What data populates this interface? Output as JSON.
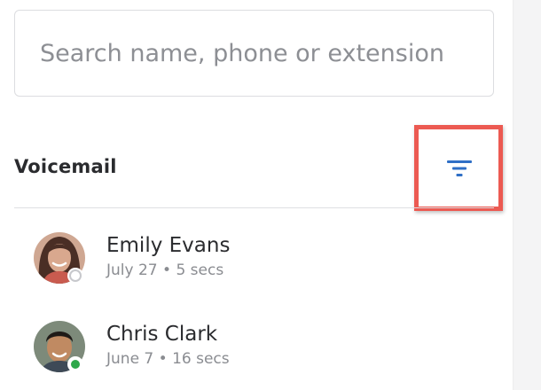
{
  "search": {
    "placeholder": "Search name, phone or extension",
    "value": ""
  },
  "voicemail": {
    "title": "Voicemail",
    "filter_icon": "filter-icon",
    "accent_color": "#2f6fc6",
    "highlight_color": "#ec5a52",
    "items": [
      {
        "name": "Emily Evans",
        "meta": "July 27 • 5 secs",
        "status": "offline",
        "avatar_icon": "avatar-woman"
      },
      {
        "name": "Chris Clark",
        "meta": "June 7 • 16 secs",
        "status": "online",
        "status_color": "#2ea84a",
        "avatar_icon": "avatar-man"
      }
    ]
  }
}
